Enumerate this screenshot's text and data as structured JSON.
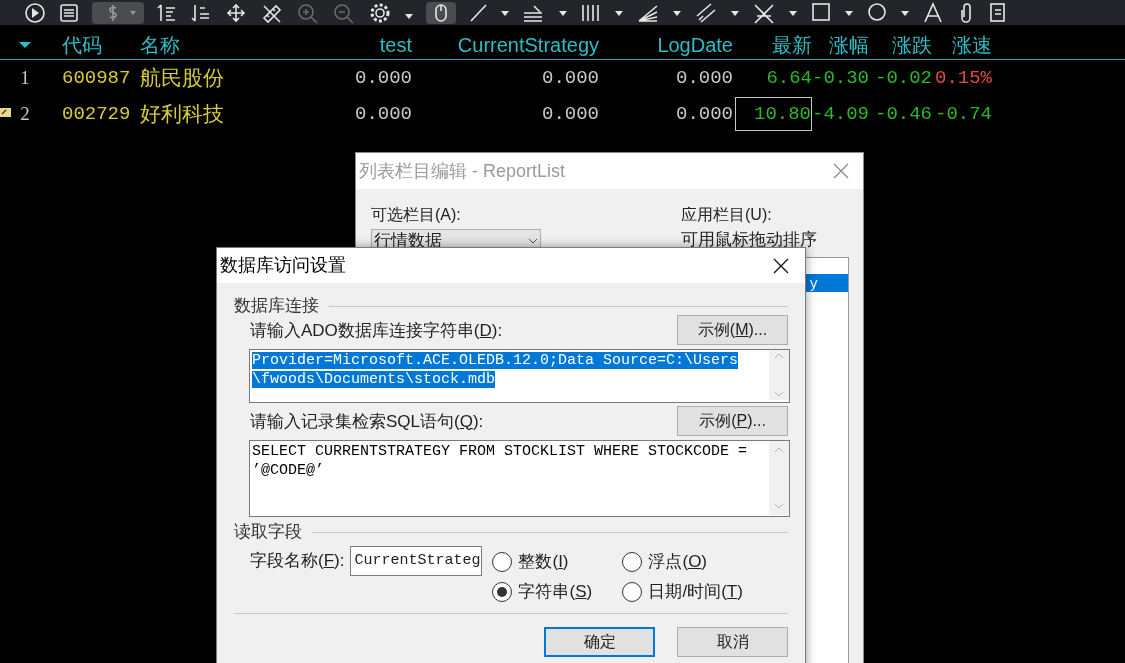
{
  "table": {
    "columns": [
      {
        "kind": "sort"
      },
      {
        "kind": "text",
        "label": "代码"
      },
      {
        "kind": "text",
        "label": "名称"
      },
      {
        "kind": "text",
        "label": "test"
      },
      {
        "kind": "text",
        "label": "CurrentStrategy"
      },
      {
        "kind": "text",
        "label": "LogDate"
      },
      {
        "kind": "text",
        "label": "最新"
      },
      {
        "kind": "text",
        "label": "涨幅"
      },
      {
        "kind": "text",
        "label": "涨跌"
      },
      {
        "kind": "text",
        "label": "涨速"
      }
    ],
    "rows": [
      {
        "marked": false,
        "cells": [
          {
            "text": "1",
            "color": "#c8c8c8",
            "focused": false
          },
          {
            "text": "600987",
            "color": "#d8cc30",
            "focused": false
          },
          {
            "text": "航民股份",
            "color": "#d8cc30",
            "focused": false
          },
          {
            "text": "0.000",
            "color": "#c8c8c8",
            "focused": false
          },
          {
            "text": "0.000",
            "color": "#c8c8c8",
            "focused": false
          },
          {
            "text": "0.000",
            "color": "#c8c8c8",
            "focused": false
          },
          {
            "text": "6.64",
            "color": "#2ab82a",
            "focused": false
          },
          {
            "text": "-0.30",
            "color": "#2ab82a",
            "focused": false
          },
          {
            "text": "-0.02",
            "color": "#2ab82a",
            "focused": false
          },
          {
            "text": "0.15%",
            "color": "#e04a40",
            "focused": false
          }
        ]
      },
      {
        "marked": true,
        "cells": [
          {
            "text": "2",
            "color": "#c8c8c8",
            "focused": false
          },
          {
            "text": "002729",
            "color": "#d8cc30",
            "focused": false
          },
          {
            "text": "好利科技",
            "color": "#d8cc30",
            "focused": false
          },
          {
            "text": "0.000",
            "color": "#c8c8c8",
            "focused": false
          },
          {
            "text": "0.000",
            "color": "#c8c8c8",
            "focused": false
          },
          {
            "text": "0.000",
            "color": "#c8c8c8",
            "focused": false
          },
          {
            "text": "10.80",
            "color": "#2ab82a",
            "focused": true
          },
          {
            "text": "-4.09",
            "color": "#2ab82a",
            "focused": false
          },
          {
            "text": "-0.46",
            "color": "#2ab82a",
            "focused": false
          },
          {
            "text": "-0.74",
            "color": "#2ab82a",
            "focused": false
          }
        ]
      }
    ]
  },
  "back_dialog": {
    "title": "列表栏目编辑 - ReportList",
    "available_label": "可选栏目(A):",
    "category_dropdown": "行情数据",
    "applied_label": "应用栏目(U):",
    "applied_hint": "可用鼠标拖动排序",
    "applied_items": [
      {
        "text": "y",
        "selected": true
      }
    ]
  },
  "dialog": {
    "title": "数据库访问设置",
    "connection_group": "数据库连接",
    "connection_label": {
      "pre": "请输入ADO数据库连接字符串(",
      "key": "D",
      "post": "):"
    },
    "connection_example": {
      "pre": "示例(",
      "key": "M",
      "post": ")..."
    },
    "connection_lines": [
      "Provider=Microsoft.ACE.OLEDB.12.0;Data Source=C:\\Users",
      "\\fwoods\\Documents\\stock.mdb"
    ],
    "connection_selected": true,
    "sql_label": {
      "pre": "请输入记录集检索SQL语句(",
      "key": "Q",
      "post": "):"
    },
    "sql_example": {
      "pre": "示例(",
      "key": "P",
      "post": ")..."
    },
    "sql_lines": [
      "SELECT CURRENTSTRATEGY FROM STOCKLIST WHERE STOCKCODE =",
      "’@CODE@’"
    ],
    "field_group": "读取字段",
    "field_label": {
      "pre": "字段名称(",
      "key": "F",
      "post": "):"
    },
    "field_value": "CurrentStrateg",
    "types": [
      {
        "pre": "整数(",
        "key": "I",
        "post": ")",
        "selected": false
      },
      {
        "pre": "浮点(",
        "key": "O",
        "post": ")",
        "selected": false
      },
      {
        "pre": "字符串(",
        "key": "S",
        "post": ")",
        "selected": true
      },
      {
        "pre": "日期/时间(",
        "key": "T",
        "post": ")",
        "selected": false
      }
    ],
    "buttons": [
      {
        "pre": "确定",
        "default": true
      },
      {
        "pre": "取消",
        "default": false
      }
    ]
  }
}
